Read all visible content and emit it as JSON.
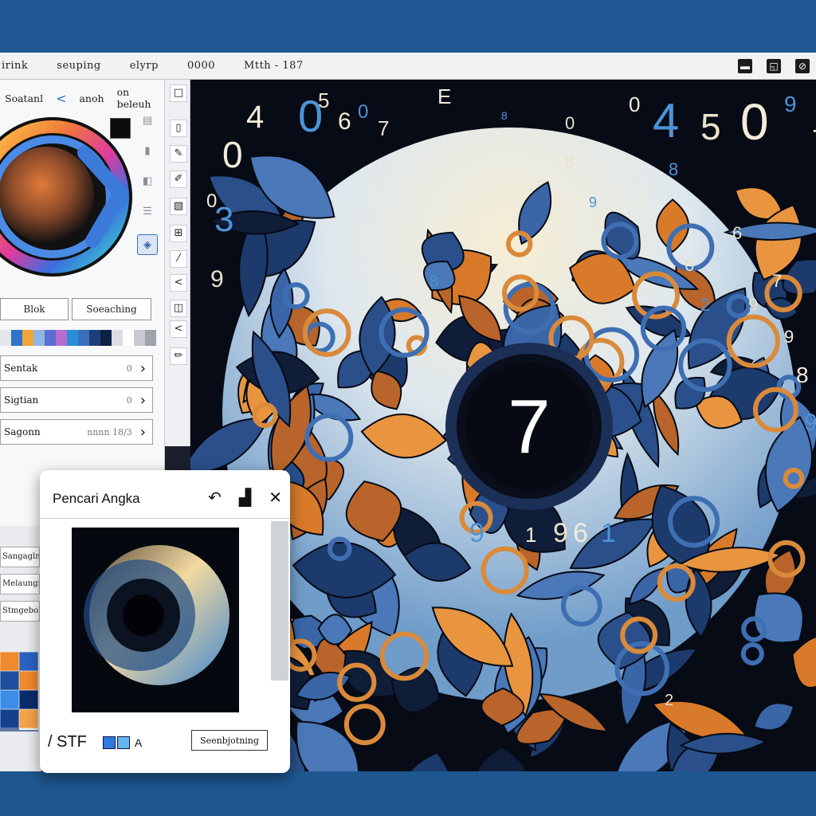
{
  "menubar": {
    "items": [
      "irink",
      "seuping",
      "elyrp",
      "0000",
      "Mtth - 187"
    ]
  },
  "window_controls": [
    "minimize",
    "restore",
    "close"
  ],
  "left_panel": {
    "header": {
      "label1": "Soatanl",
      "label2": "anoh",
      "label3": "on beleuh"
    },
    "buttons": [
      "Blok",
      "Soeaching"
    ],
    "palette_colors": [
      "#e6e7ea",
      "#2f74c6",
      "#f2a53a",
      "#8fb7e6",
      "#5a6fd1",
      "#b86bd0",
      "#2c8ed8",
      "#3a6fba",
      "#1c3f78",
      "#0e1f44",
      "#dbdde1",
      "#ffffff",
      "#c7cad0",
      "#9da3ab"
    ],
    "properties": [
      {
        "label": "Sentak",
        "value": "0"
      },
      {
        "label": "Sigtian",
        "value": "0"
      },
      {
        "label": "Sagonn",
        "value": "nnnn 18/3"
      }
    ],
    "lower_items": [
      "Sangaglne",
      "Melaungr",
      "Stmgebolt"
    ],
    "grid_colors": [
      "#f08a2c",
      "#2a62c0",
      "#1f4e9c",
      "#f08a2c",
      "#3b8de6",
      "#0b2c6a",
      "#14418c",
      "#f5a34a",
      "#0e2f6e",
      "#e8ecf2",
      "#1a3d7c",
      "#1a3d7c"
    ]
  },
  "toolbar": {
    "icons": [
      "square-icon",
      "panel-icon",
      "brush-icon",
      "pen-icon",
      "image-icon",
      "crop-icon",
      "line-icon",
      "chevron-icon",
      "frame-icon",
      "arrow-icon",
      "pencil-icon"
    ]
  },
  "canvas": {
    "center_number": "7",
    "scattered_numbers": [
      "4",
      "0",
      "5",
      "6",
      "0",
      "7",
      "E",
      "8",
      "0",
      "0",
      "4",
      "5",
      "0",
      "9",
      "7",
      "0",
      "8",
      "8",
      "0",
      "9",
      "6",
      "0",
      "3",
      "9",
      "8",
      "9",
      "2",
      "1",
      "9",
      "9",
      "6",
      "1",
      "9",
      "9",
      "8",
      "6",
      "7",
      "2"
    ]
  },
  "dialog": {
    "title": "Pencari Angka",
    "format_label": "/ STF",
    "a_label": "A",
    "button": "Seenbjotning"
  }
}
